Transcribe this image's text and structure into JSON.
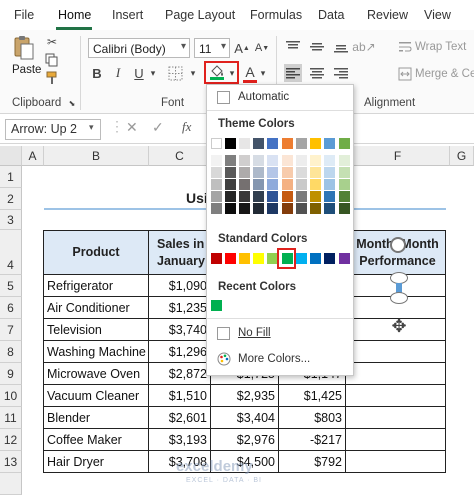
{
  "menu": {
    "tabs": [
      "File",
      "Home",
      "Insert",
      "Page Layout",
      "Formulas",
      "Data",
      "Review",
      "View"
    ]
  },
  "ribbon": {
    "paste_label": "Paste",
    "clipboard_label": "Clipboard",
    "font_name": "Calibri (Body)",
    "font_size": "11",
    "font_group_label": "Font",
    "bold": "B",
    "italic": "I",
    "underline": "U",
    "font_color_letter": "A",
    "wrap_text": "Wrap Text",
    "merge_center": "Merge & Ce",
    "alignment_label": "Alignment"
  },
  "formula_bar": {
    "name_box": "Arrow: Up 2",
    "fx": "fx"
  },
  "grid": {
    "columns": [
      "A",
      "B",
      "C",
      "D",
      "E",
      "F",
      "G"
    ],
    "rows": [
      "1",
      "2",
      "3",
      "4",
      "5",
      "6",
      "7",
      "8",
      "9",
      "10",
      "11",
      "12",
      "13"
    ],
    "title_partial": "Usi",
    "headers": {
      "product": "Product",
      "sales_jan": "Sales in January",
      "mom": "Month -Month Performance"
    },
    "products": [
      "Refrigerator",
      "Air Conditioner",
      "Television",
      "Washing Machine",
      "Microwave Oven",
      "Vacuum Cleaner",
      "Blender",
      "Coffee Maker",
      "Hair Dryer"
    ],
    "sales_jan": [
      "$1,090",
      "$1,235",
      "$3,740",
      "$1,296",
      "$2,872",
      "$1,510",
      "$2,601",
      "$3,193",
      "$3,708"
    ],
    "sales_d": [
      "",
      "",
      "",
      "",
      "$1,725",
      "$2,935",
      "$3,404",
      "$2,976",
      "$4,500"
    ],
    "diff": [
      "",
      "",
      "",
      "",
      "-$1,147",
      "$1,425",
      "$803",
      "-$217",
      "$792"
    ]
  },
  "color_panel": {
    "automatic": "Automatic",
    "theme_colors": "Theme Colors",
    "standard_colors": "Standard Colors",
    "recent_colors": "Recent Colors",
    "no_fill": "No Fill",
    "more_colors": "More Colors...",
    "theme_top": [
      "#ffffff",
      "#000000",
      "#e7e6e6",
      "#44546a",
      "#4472c4",
      "#ed7d31",
      "#a5a5a5",
      "#ffc000",
      "#5b9bd5",
      "#70ad47"
    ],
    "theme_shades": [
      [
        "#f2f2f2",
        "#7f7f7f",
        "#d0cece",
        "#d6dce4",
        "#d9e2f3",
        "#fbe5d5",
        "#ededed",
        "#fff2cc",
        "#deebf6",
        "#e2efd9"
      ],
      [
        "#d8d8d8",
        "#595959",
        "#aeabab",
        "#adb9ca",
        "#b4c6e7",
        "#f7cbac",
        "#dbdbdb",
        "#fee599",
        "#bdd7ee",
        "#c5e0b3"
      ],
      [
        "#bfbfbf",
        "#3f3f3f",
        "#757070",
        "#8496b0",
        "#8eaadb",
        "#f4b183",
        "#c9c9c9",
        "#ffd965",
        "#9cc3e5",
        "#a8d08d"
      ],
      [
        "#a5a5a5",
        "#262626",
        "#3a3838",
        "#323f4f",
        "#2f5496",
        "#c55a11",
        "#7b7b7b",
        "#bf9000",
        "#2e75b5",
        "#538135"
      ],
      [
        "#7f7f7f",
        "#0c0c0c",
        "#171616",
        "#222a35",
        "#1e3864",
        "#833c0b",
        "#525252",
        "#7f6000",
        "#1e4e79",
        "#375623"
      ]
    ],
    "standard": [
      "#c00000",
      "#ff0000",
      "#ffc000",
      "#ffff00",
      "#92d050",
      "#00b050",
      "#00b0f0",
      "#0070c0",
      "#002060",
      "#7030a0"
    ],
    "recent": [
      "#00b050"
    ]
  },
  "watermark": "exceldemy",
  "watermark_sub": "EXCEL · DATA · BI"
}
